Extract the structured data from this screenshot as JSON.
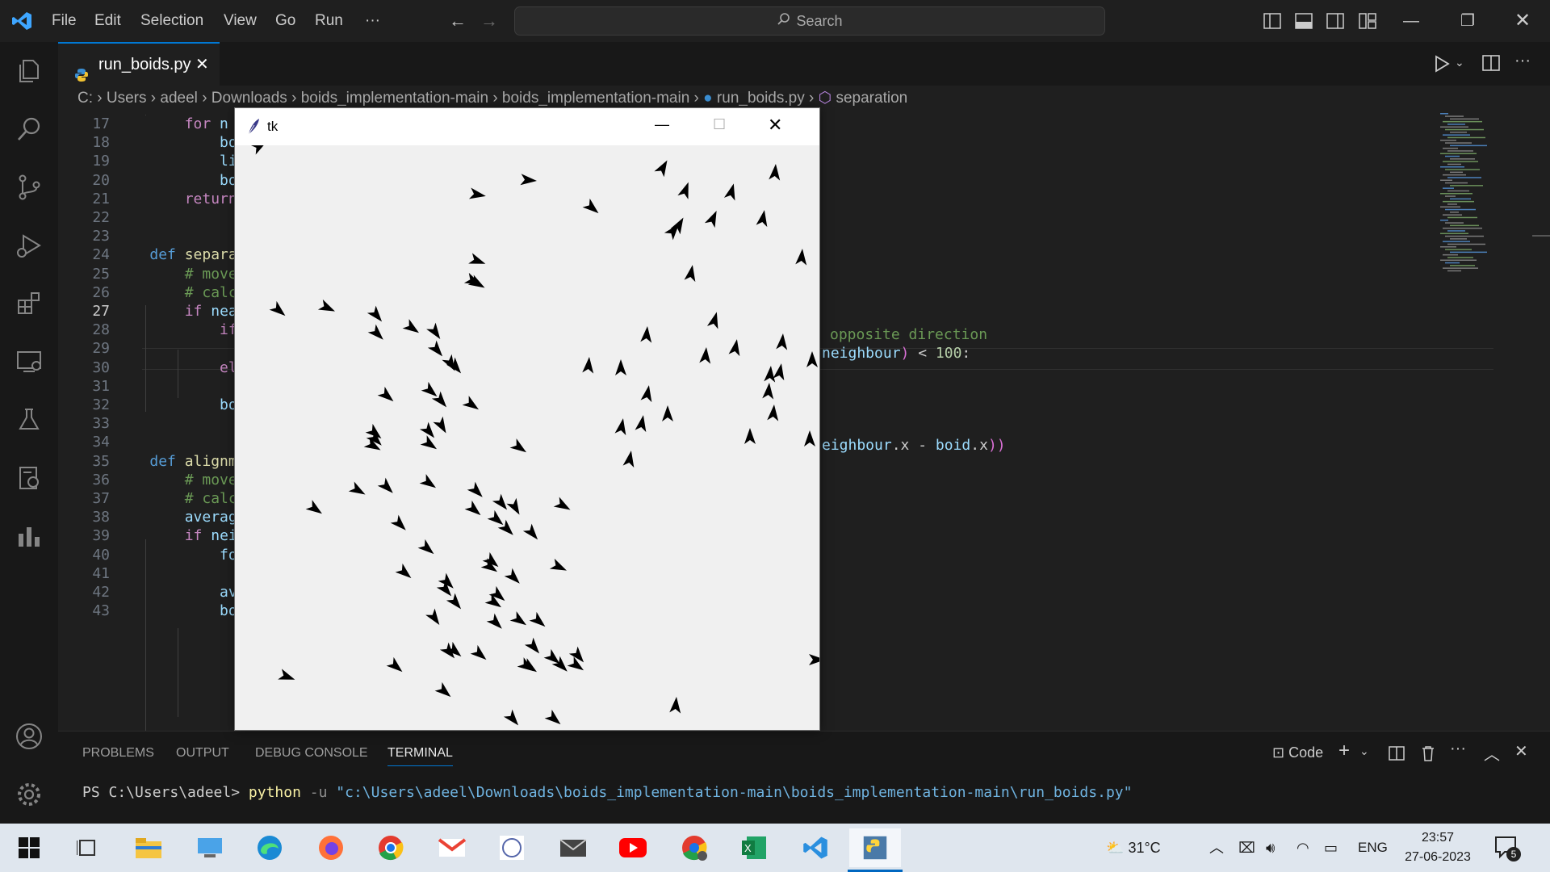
{
  "titlebar": {
    "menu": [
      "File",
      "Edit",
      "Selection",
      "View",
      "Go",
      "Run",
      "···"
    ],
    "search_placeholder": "Search"
  },
  "tab": {
    "label": "run_boids.py"
  },
  "breadcrumb": [
    "C:",
    "Users",
    "adeel",
    "Downloads",
    "boids_implementation-main",
    "boids_implementation-main",
    "run_boids.py",
    "separation"
  ],
  "editor": {
    "active_line": "27",
    "lines": [
      {
        "n": "17",
        "code": "        for n"
      },
      {
        "n": "18",
        "code": "            bo"
      },
      {
        "n": "19",
        "code": "            li"
      },
      {
        "n": "20",
        "code": "            bo"
      },
      {
        "n": "21",
        "code": "        return"
      },
      {
        "n": "22",
        "code": ""
      },
      {
        "n": "23",
        "code": ""
      },
      {
        "n": "24",
        "code": "    def separa"
      },
      {
        "n": "25",
        "code": "        # move"
      },
      {
        "n": "26",
        "code": "        # calc"
      },
      {
        "n": "27",
        "code": "        if nea"
      },
      {
        "n": "28",
        "code": "            if"
      },
      {
        "n": "29",
        "code": ""
      },
      {
        "n": "30",
        "code": "            el"
      },
      {
        "n": "31",
        "code": ""
      },
      {
        "n": "32",
        "code": "            bo"
      },
      {
        "n": "33",
        "code": ""
      },
      {
        "n": "34",
        "code": ""
      },
      {
        "n": "35",
        "code": "    def alignm"
      },
      {
        "n": "36",
        "code": "        # move"
      },
      {
        "n": "37",
        "code": "        # calc"
      },
      {
        "n": "38",
        "code": "        averag"
      },
      {
        "n": "39",
        "code": "        if nei"
      },
      {
        "n": "40",
        "code": "            fo"
      },
      {
        "n": "41",
        "code": ""
      },
      {
        "n": "42",
        "code": "            av"
      },
      {
        "n": "43",
        "code": "            bo"
      }
    ],
    "right_fragments": {
      "line26": "opposite direction",
      "line27_a": "neighbour",
      "line27_b": " < ",
      "line27_c": "100",
      "line27_d": ":",
      "line31_a": "eighbour",
      "line31_b": ".x - ",
      "line31_c": "boid",
      "line31_d": ".x",
      "line31_e": "))"
    }
  },
  "panel": {
    "tabs": [
      "PROBLEMS",
      "OUTPUT",
      "DEBUG CONSOLE",
      "TERMINAL"
    ],
    "active_tab": "TERMINAL",
    "terminal_profile": "Code",
    "prompt": "PS C:\\Users\\adeel> ",
    "command": "python",
    "flag": " -u ",
    "path": "\"c:\\Users\\adeel\\Downloads\\boids_implementation-main\\boids_implementation-main\\run_boids.py\""
  },
  "tk": {
    "title": "tk",
    "boids": [
      [
        320,
        180,
        60
      ],
      [
        590,
        240,
        100
      ],
      [
        653,
        222,
        95
      ],
      [
        732,
        256,
        130
      ],
      [
        820,
        207,
        30
      ],
      [
        848,
        235,
        20
      ],
      [
        905,
        237,
        15
      ],
      [
        959,
        213,
        5
      ],
      [
        840,
        278,
        30
      ],
      [
        833,
        285,
        40
      ],
      [
        882,
        270,
        25
      ],
      [
        944,
        270,
        10
      ],
      [
        590,
        322,
        110
      ],
      [
        585,
        347,
        115
      ],
      [
        590,
        350,
        120
      ],
      [
        855,
        338,
        10
      ],
      [
        992,
        318,
        5
      ],
      [
        344,
        383,
        130
      ],
      [
        404,
        380,
        115
      ],
      [
        465,
        389,
        140
      ],
      [
        466,
        412,
        135
      ],
      [
        509,
        405,
        125
      ],
      [
        538,
        410,
        145
      ],
      [
        540,
        432,
        140
      ],
      [
        557,
        449,
        150
      ],
      [
        563,
        453,
        140
      ],
      [
        800,
        414,
        5
      ],
      [
        884,
        396,
        15
      ],
      [
        728,
        452,
        5
      ],
      [
        768,
        455,
        0
      ],
      [
        873,
        440,
        5
      ],
      [
        910,
        430,
        10
      ],
      [
        968,
        423,
        5
      ],
      [
        1005,
        445,
        0
      ],
      [
        953,
        463,
        5
      ],
      [
        965,
        460,
        10
      ],
      [
        951,
        484,
        5
      ],
      [
        801,
        487,
        10
      ],
      [
        478,
        489,
        130
      ],
      [
        532,
        483,
        130
      ],
      [
        545,
        495,
        140
      ],
      [
        583,
        500,
        125
      ],
      [
        530,
        533,
        140
      ],
      [
        546,
        526,
        150
      ],
      [
        769,
        528,
        10
      ],
      [
        794,
        524,
        10
      ],
      [
        826,
        512,
        0
      ],
      [
        957,
        511,
        5
      ],
      [
        928,
        540,
        0
      ],
      [
        1002,
        543,
        0
      ],
      [
        463,
        535,
        130
      ],
      [
        464,
        543,
        135
      ],
      [
        461,
        551,
        120
      ],
      [
        531,
        549,
        125
      ],
      [
        642,
        553,
        125
      ],
      [
        779,
        568,
        10
      ],
      [
        530,
        597,
        125
      ],
      [
        442,
        606,
        120
      ],
      [
        478,
        602,
        135
      ],
      [
        589,
        607,
        135
      ],
      [
        620,
        622,
        140
      ],
      [
        637,
        627,
        150
      ],
      [
        586,
        630,
        130
      ],
      [
        614,
        642,
        130
      ],
      [
        627,
        654,
        135
      ],
      [
        696,
        625,
        120
      ],
      [
        658,
        659,
        140
      ],
      [
        389,
        629,
        125
      ],
      [
        494,
        648,
        135
      ],
      [
        528,
        678,
        130
      ],
      [
        608,
        694,
        130
      ],
      [
        606,
        701,
        125
      ],
      [
        635,
        714,
        135
      ],
      [
        691,
        701,
        115
      ],
      [
        500,
        708,
        130
      ],
      [
        553,
        720,
        135
      ],
      [
        551,
        729,
        140
      ],
      [
        563,
        745,
        140
      ],
      [
        616,
        736,
        130
      ],
      [
        611,
        745,
        125
      ],
      [
        642,
        767,
        125
      ],
      [
        666,
        768,
        130
      ],
      [
        613,
        770,
        135
      ],
      [
        537,
        764,
        145
      ],
      [
        562,
        805,
        130
      ],
      [
        593,
        809,
        130
      ],
      [
        660,
        800,
        140
      ],
      [
        655,
        825,
        125
      ],
      [
        684,
        814,
        130
      ],
      [
        694,
        823,
        135
      ],
      [
        715,
        811,
        140
      ],
      [
        651,
        824,
        125
      ],
      [
        713,
        823,
        125
      ],
      [
        489,
        824,
        130
      ],
      [
        555,
        806,
        140
      ],
      [
        549,
        855,
        130
      ],
      [
        354,
        837,
        110
      ],
      [
        1010,
        816,
        90
      ],
      [
        836,
        873,
        5
      ],
      [
        634,
        889,
        140
      ],
      [
        685,
        889,
        130
      ]
    ]
  },
  "taskbar": {
    "weather": "31°C",
    "lang": "ENG",
    "time": "23:57",
    "date": "27-06-2023",
    "notifications": "5"
  },
  "colors": {
    "accent": "#0078d4",
    "editor_bg": "#1f1f1f",
    "keyword": "#569cd6",
    "comment": "#6a9955"
  }
}
